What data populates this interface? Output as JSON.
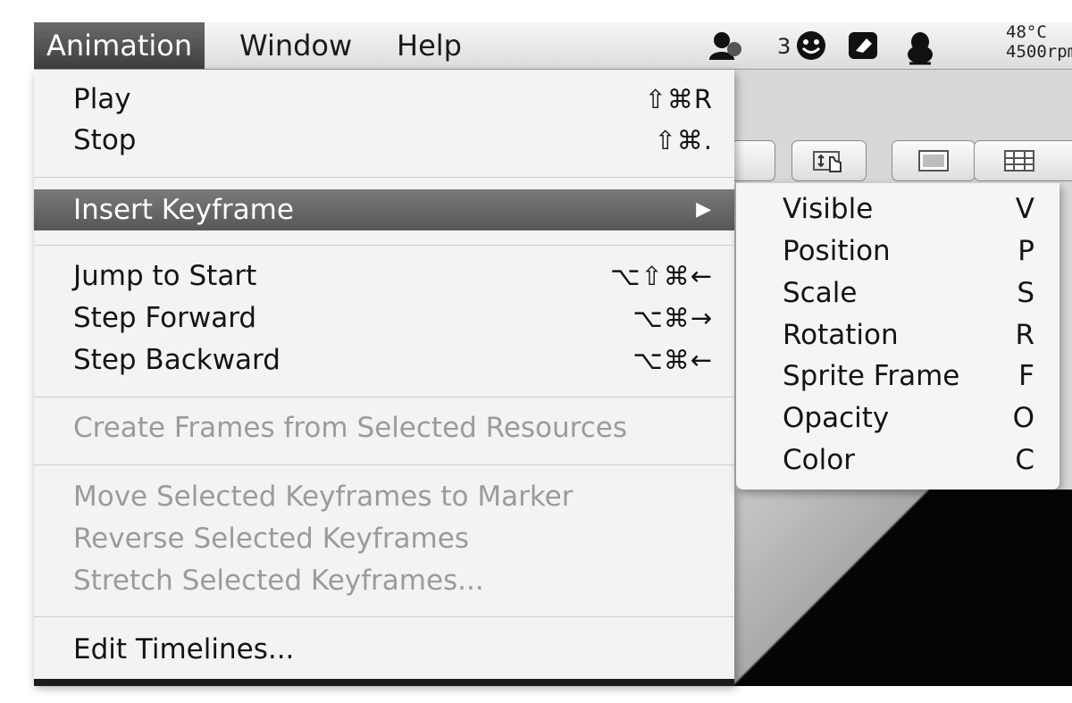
{
  "menubar": {
    "items": [
      {
        "label": "Animation",
        "active": true
      },
      {
        "label": "Window",
        "active": false
      },
      {
        "label": "Help",
        "active": false
      }
    ],
    "tray": {
      "notification_count": "3",
      "temperature": "48°C",
      "fan_speed": "4500rpm",
      "icons": [
        "chat-people-icon",
        "smiley-icon",
        "eraser-icon",
        "penguin-icon"
      ]
    }
  },
  "dropdown": {
    "items": [
      {
        "label": "Play",
        "shortcut": "⇧⌘R",
        "enabled": true
      },
      {
        "label": "Stop",
        "shortcut": "⇧⌘.",
        "enabled": true
      },
      {
        "label": "Insert Keyframe",
        "shortcut": "",
        "enabled": true,
        "submenu": true,
        "highlighted": true,
        "arrow": "▶"
      },
      {
        "label": "Jump to Start",
        "shortcut": "⌥⇧⌘←",
        "enabled": true
      },
      {
        "label": "Step Forward",
        "shortcut": "⌥⌘→",
        "enabled": true
      },
      {
        "label": "Step Backward",
        "shortcut": "⌥⌘←",
        "enabled": true
      },
      {
        "label": "Create Frames from Selected Resources",
        "shortcut": "",
        "enabled": false
      },
      {
        "label": "Move Selected Keyframes to Marker",
        "shortcut": "",
        "enabled": false
      },
      {
        "label": "Reverse Selected Keyframes",
        "shortcut": "",
        "enabled": false
      },
      {
        "label": "Stretch Selected Keyframes...",
        "shortcut": "",
        "enabled": false
      },
      {
        "label": "Edit Timelines...",
        "shortcut": "",
        "enabled": true
      }
    ]
  },
  "submenu": {
    "items": [
      {
        "label": "Visible",
        "shortcut": "V"
      },
      {
        "label": "Position",
        "shortcut": "P"
      },
      {
        "label": "Scale",
        "shortcut": "S"
      },
      {
        "label": "Rotation",
        "shortcut": "R"
      },
      {
        "label": "Sprite Frame",
        "shortcut": "F"
      },
      {
        "label": "Opacity",
        "shortcut": "O"
      },
      {
        "label": "Color",
        "shortcut": "C"
      }
    ]
  },
  "colors": {
    "menu_highlight": "#6a6a6a",
    "disabled_text": "#9b9b9b",
    "menu_background": "#f3f3f3"
  }
}
